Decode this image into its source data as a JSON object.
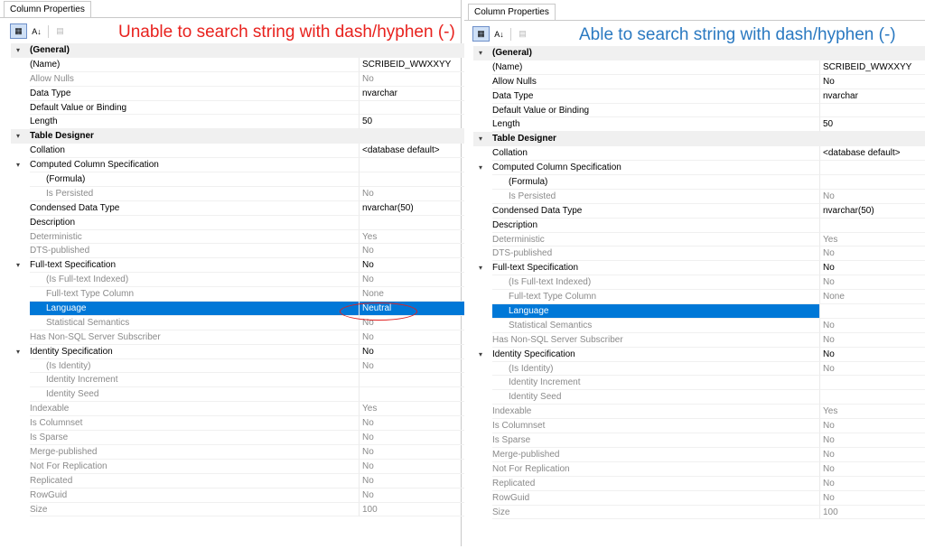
{
  "left": {
    "tab_label": "Column Properties",
    "annotation": "Unable to search string with dash/hyphen (-)",
    "rows": [
      {
        "name": "(General)",
        "value": "",
        "kind": "category"
      },
      {
        "name": "(Name)",
        "value": "SCRIBEID_WWXXYY",
        "kind": "normal"
      },
      {
        "name": "Allow Nulls",
        "value": "No",
        "kind": "disabled"
      },
      {
        "name": "Data Type",
        "value": "nvarchar",
        "kind": "normal"
      },
      {
        "name": "Default Value or Binding",
        "value": "",
        "kind": "normal"
      },
      {
        "name": "Length",
        "value": "50",
        "kind": "normal"
      },
      {
        "name": "Table Designer",
        "value": "",
        "kind": "category"
      },
      {
        "name": "Collation",
        "value": "<database default>",
        "kind": "normal"
      },
      {
        "name": "Computed Column Specification",
        "value": "",
        "kind": "expandable"
      },
      {
        "name": "(Formula)",
        "value": "",
        "kind": "indent"
      },
      {
        "name": "Is Persisted",
        "value": "No",
        "kind": "indent-disabled"
      },
      {
        "name": "Condensed Data Type",
        "value": "nvarchar(50)",
        "kind": "normal"
      },
      {
        "name": "Description",
        "value": "",
        "kind": "normal"
      },
      {
        "name": "Deterministic",
        "value": "Yes",
        "kind": "disabled"
      },
      {
        "name": "DTS-published",
        "value": "No",
        "kind": "disabled"
      },
      {
        "name": "Full-text Specification",
        "value": "No",
        "kind": "expandable"
      },
      {
        "name": "(Is Full-text Indexed)",
        "value": "No",
        "kind": "indent-disabled"
      },
      {
        "name": "Full-text Type Column",
        "value": "None",
        "kind": "indent-disabled"
      },
      {
        "name": "Language",
        "value": "Neutral",
        "kind": "selected-left"
      },
      {
        "name": "Statistical Semantics",
        "value": "No",
        "kind": "indent-disabled"
      },
      {
        "name": "Has Non-SQL Server Subscriber",
        "value": "No",
        "kind": "disabled"
      },
      {
        "name": "Identity Specification",
        "value": "No",
        "kind": "expandable"
      },
      {
        "name": "(Is Identity)",
        "value": "No",
        "kind": "indent-disabled"
      },
      {
        "name": "Identity Increment",
        "value": "",
        "kind": "indent-disabled"
      },
      {
        "name": "Identity Seed",
        "value": "",
        "kind": "indent-disabled"
      },
      {
        "name": "Indexable",
        "value": "Yes",
        "kind": "disabled"
      },
      {
        "name": "Is Columnset",
        "value": "No",
        "kind": "disabled"
      },
      {
        "name": "Is Sparse",
        "value": "No",
        "kind": "disabled"
      },
      {
        "name": "Merge-published",
        "value": "No",
        "kind": "disabled"
      },
      {
        "name": "Not For Replication",
        "value": "No",
        "kind": "disabled"
      },
      {
        "name": "Replicated",
        "value": "No",
        "kind": "disabled"
      },
      {
        "name": "RowGuid",
        "value": "No",
        "kind": "disabled"
      },
      {
        "name": "Size",
        "value": "100",
        "kind": "disabled"
      }
    ]
  },
  "right": {
    "tab_label": "Column Properties",
    "annotation": "Able to search string with dash/hyphen (-)",
    "rows": [
      {
        "name": "(General)",
        "value": "",
        "kind": "category"
      },
      {
        "name": "(Name)",
        "value": "SCRIBEID_WWXXYY",
        "kind": "normal"
      },
      {
        "name": "Allow Nulls",
        "value": "No",
        "kind": "normal"
      },
      {
        "name": "Data Type",
        "value": "nvarchar",
        "kind": "normal"
      },
      {
        "name": "Default Value or Binding",
        "value": "",
        "kind": "normal"
      },
      {
        "name": "Length",
        "value": "50",
        "kind": "normal"
      },
      {
        "name": "Table Designer",
        "value": "",
        "kind": "category"
      },
      {
        "name": "Collation",
        "value": "<database default>",
        "kind": "normal"
      },
      {
        "name": "Computed Column Specification",
        "value": "",
        "kind": "expandable"
      },
      {
        "name": "(Formula)",
        "value": "",
        "kind": "indent"
      },
      {
        "name": "Is Persisted",
        "value": "No",
        "kind": "indent-disabled"
      },
      {
        "name": "Condensed Data Type",
        "value": "nvarchar(50)",
        "kind": "normal"
      },
      {
        "name": "Description",
        "value": "",
        "kind": "normal"
      },
      {
        "name": "Deterministic",
        "value": "Yes",
        "kind": "disabled"
      },
      {
        "name": "DTS-published",
        "value": "No",
        "kind": "disabled"
      },
      {
        "name": "Full-text Specification",
        "value": "No",
        "kind": "expandable"
      },
      {
        "name": "(Is Full-text Indexed)",
        "value": "No",
        "kind": "indent-disabled"
      },
      {
        "name": "Full-text Type Column",
        "value": "None",
        "kind": "indent-disabled"
      },
      {
        "name": "Language",
        "value": "",
        "kind": "selected-right"
      },
      {
        "name": "Statistical Semantics",
        "value": "No",
        "kind": "indent-disabled"
      },
      {
        "name": "Has Non-SQL Server Subscriber",
        "value": "No",
        "kind": "disabled"
      },
      {
        "name": "Identity Specification",
        "value": "No",
        "kind": "expandable"
      },
      {
        "name": "(Is Identity)",
        "value": "No",
        "kind": "indent-disabled"
      },
      {
        "name": "Identity Increment",
        "value": "",
        "kind": "indent-disabled"
      },
      {
        "name": "Identity Seed",
        "value": "",
        "kind": "indent-disabled"
      },
      {
        "name": "Indexable",
        "value": "Yes",
        "kind": "disabled"
      },
      {
        "name": "Is Columnset",
        "value": "No",
        "kind": "disabled"
      },
      {
        "name": "Is Sparse",
        "value": "No",
        "kind": "disabled"
      },
      {
        "name": "Merge-published",
        "value": "No",
        "kind": "disabled"
      },
      {
        "name": "Not For Replication",
        "value": "No",
        "kind": "disabled"
      },
      {
        "name": "Replicated",
        "value": "No",
        "kind": "disabled"
      },
      {
        "name": "RowGuid",
        "value": "No",
        "kind": "disabled"
      },
      {
        "name": "Size",
        "value": "100",
        "kind": "disabled"
      }
    ]
  },
  "colors": {
    "selection": "#0078d7",
    "left_annotation": "#e8221e",
    "right_annotation": "#2a79c1",
    "disabled_text": "#8a8a8a"
  },
  "icons": {
    "categorized": "categorized-view-icon",
    "alphabetical": "sort-alphabetical-icon",
    "property_pages": "property-pages-icon"
  }
}
